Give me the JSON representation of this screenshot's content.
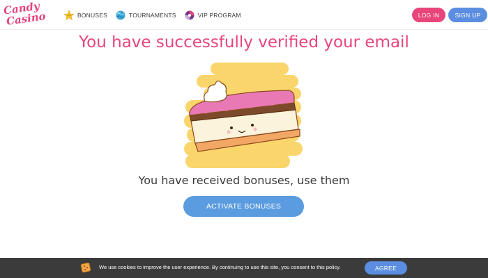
{
  "brand": {
    "line1": "Candy",
    "line2": "Casino",
    "color": "#e8457a"
  },
  "nav": {
    "items": [
      {
        "label": "BONUSES",
        "icon": "star-icon"
      },
      {
        "label": "TOURNAMENTS",
        "icon": "planet-icon"
      },
      {
        "label": "VIP PROGRAM",
        "icon": "vip-candy-icon"
      }
    ]
  },
  "auth": {
    "login_label": "LOG IN",
    "signup_label": "SIGN UP"
  },
  "main": {
    "title": "You have successfully verified your email",
    "illustration": "cake-slice-illustration",
    "subtitle": "You have received bonuses, use them",
    "activate_label": "ACTIVATE BONUSES"
  },
  "cookie_bar": {
    "text": "We use cookies to improve the user experience. By continuing to use this site, you consent to this policy.",
    "agree_label": "AGREE",
    "icon": "cookie-icon"
  },
  "colors": {
    "accent_pink": "#e8457a",
    "accent_blue": "#5b8ee0",
    "cookie_bar_bg": "#3b3b3b",
    "illustration_yellow": "#fad56b"
  }
}
